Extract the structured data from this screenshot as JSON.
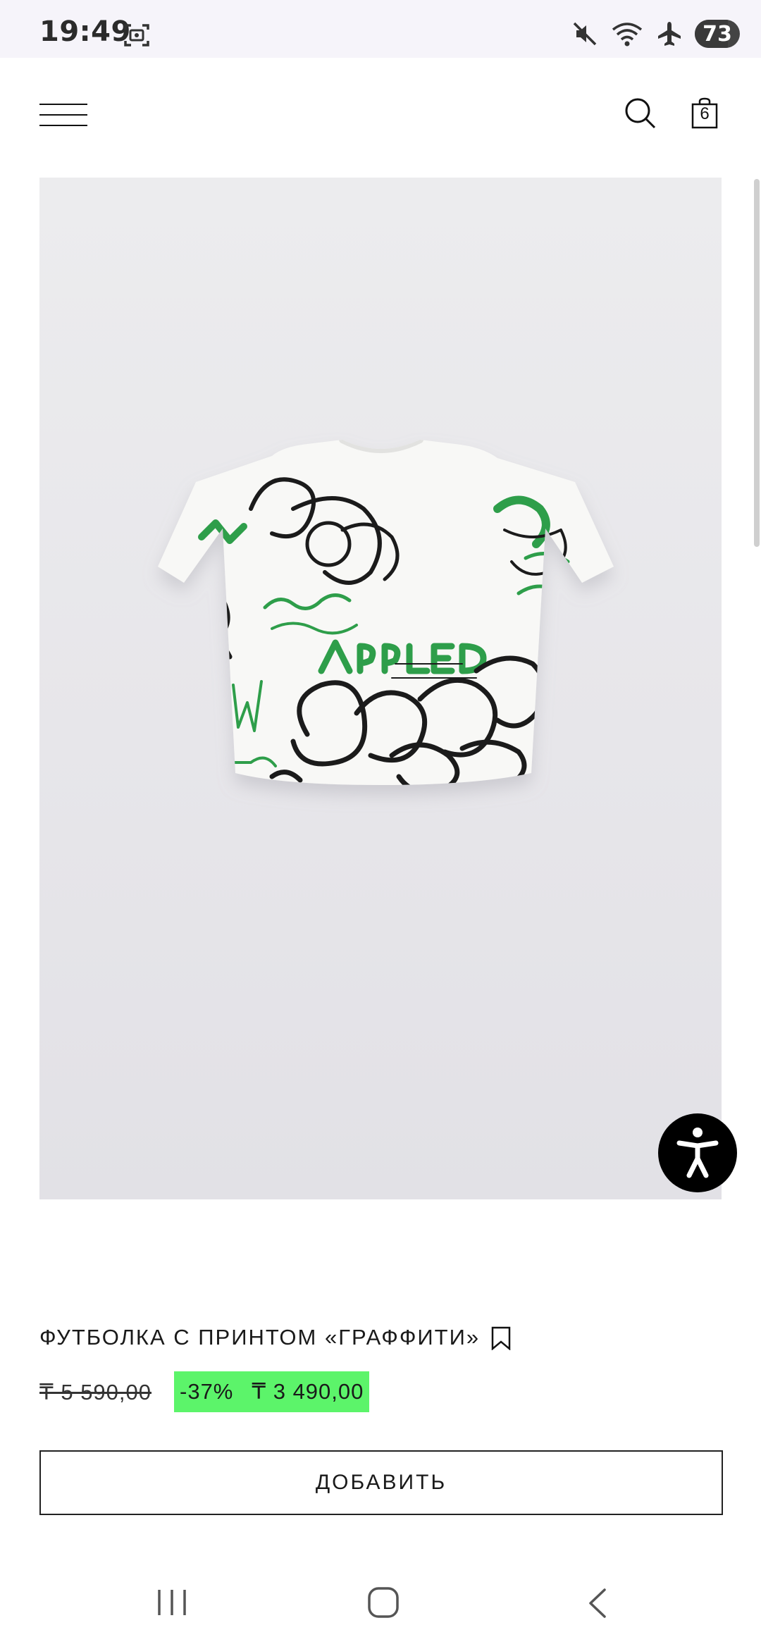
{
  "status_bar": {
    "time": "19:49",
    "battery_level": 73,
    "battery_text": "73",
    "icons": [
      "screenshot-icon",
      "mute-icon",
      "wifi-icon",
      "airplane-icon",
      "battery-icon"
    ]
  },
  "header": {
    "cart_count": "6",
    "icons": [
      "menu-icon",
      "search-icon",
      "shopping-bag-icon"
    ]
  },
  "product": {
    "image_alt": "",
    "title": "ФУТБОЛКА С ПРИНТОМ «ГРАФФИТИ»",
    "old_price": "₸ 5 590,00",
    "discount": "-37%",
    "new_price": "₸ 3 490,00",
    "add_button_label": "ДОБАВИТЬ"
  },
  "colors": {
    "sale_badge": "#5cf46a",
    "print_green": "#2e9e4a",
    "print_black": "#1b1b1b",
    "image_background": "#e9e8ec"
  },
  "accessibility": {
    "icon": "accessibility-icon"
  },
  "nav_bar": {
    "icons": [
      "recent-apps-icon",
      "home-icon",
      "back-icon"
    ]
  }
}
